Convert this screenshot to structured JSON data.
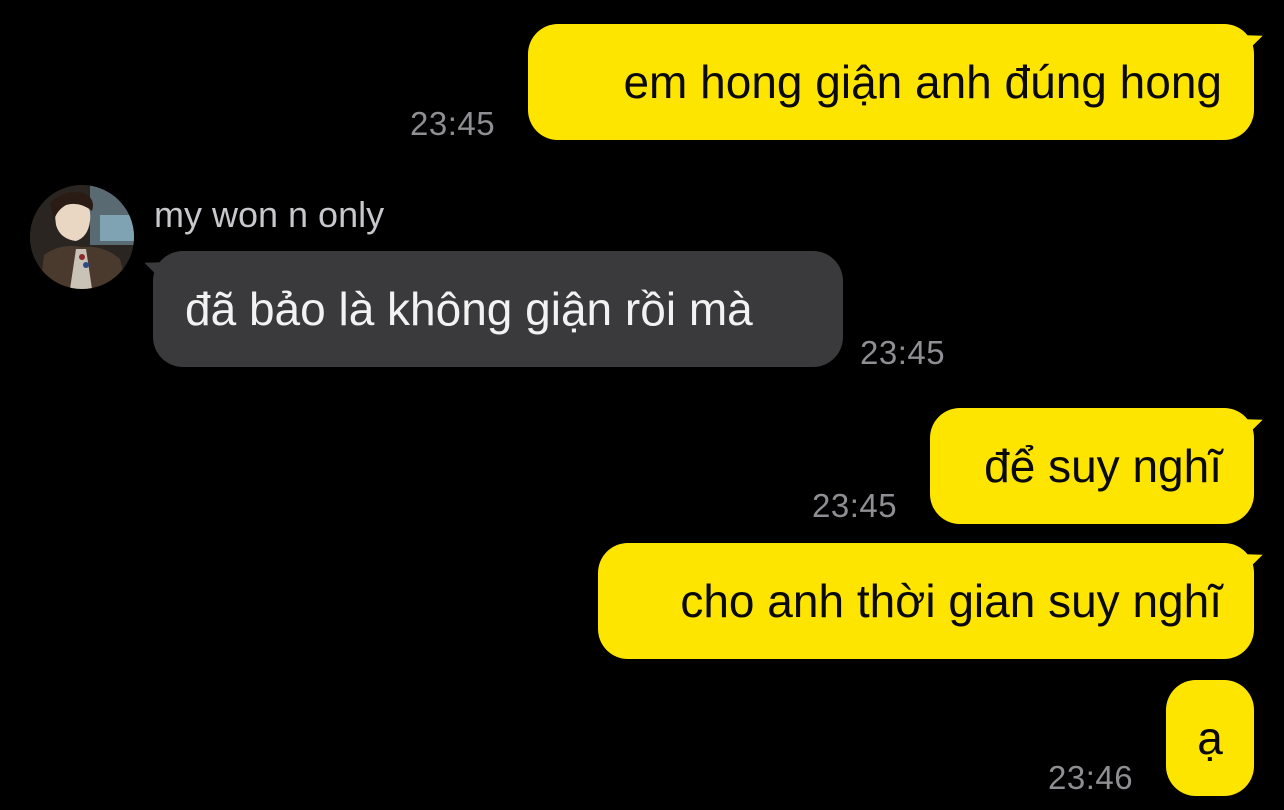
{
  "colors": {
    "background": "#000000",
    "my_bubble": "#FEE500",
    "their_bubble": "#3a3a3c",
    "timestamp": "#8e8e93"
  },
  "contact": {
    "name": "my won n only",
    "avatar_icon": "profile-photo"
  },
  "messages": [
    {
      "sender": "me",
      "text": "em hong giận anh đúng hong",
      "time": "23:45"
    },
    {
      "sender": "contact",
      "text": "đã bảo là không giận rồi mà",
      "time": "23:45"
    },
    {
      "sender": "me",
      "text": "để suy nghĩ",
      "time": "23:45"
    },
    {
      "sender": "me",
      "text": "cho anh thời gian suy nghĩ",
      "time": null
    },
    {
      "sender": "me",
      "text": "ạ",
      "time": "23:46"
    }
  ]
}
